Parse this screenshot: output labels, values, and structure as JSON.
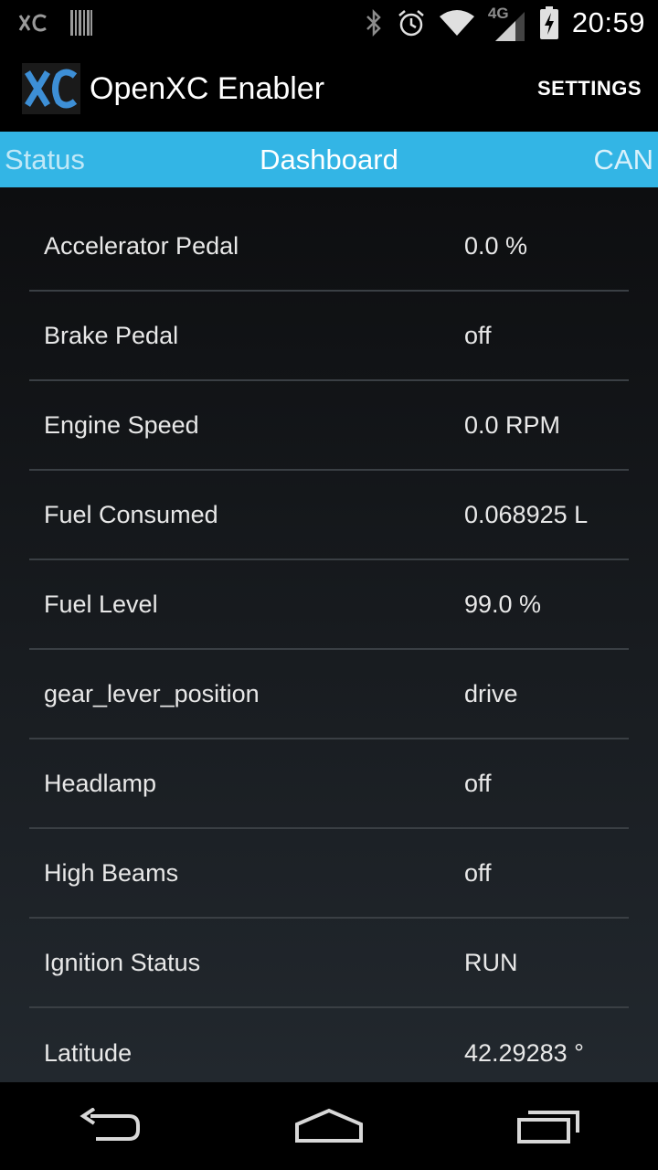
{
  "status_bar": {
    "time": "20:59",
    "network_label": "4G",
    "icons": [
      "xc-notification-icon",
      "barcode-icon",
      "bluetooth-icon",
      "alarm-icon",
      "wifi-icon",
      "signal-icon",
      "battery-charging-icon"
    ]
  },
  "action_bar": {
    "title": "OpenXC Enabler",
    "settings_label": "SETTINGS",
    "logo_icon": "openxc-logo-icon"
  },
  "tabs": {
    "left": "Status",
    "center": "Dashboard",
    "right": "CAN",
    "accent_color": "#33b5e5"
  },
  "measurements": [
    {
      "label": "Accelerator Pedal",
      "value": "0.0 %"
    },
    {
      "label": "Brake Pedal",
      "value": "off"
    },
    {
      "label": "Engine Speed",
      "value": "0.0 RPM"
    },
    {
      "label": "Fuel Consumed",
      "value": "0.068925 L"
    },
    {
      "label": "Fuel Level",
      "value": "99.0 %"
    },
    {
      "label": "gear_lever_position",
      "value": "drive"
    },
    {
      "label": "Headlamp",
      "value": "off"
    },
    {
      "label": "High Beams",
      "value": "off"
    },
    {
      "label": "Ignition Status",
      "value": "RUN"
    },
    {
      "label": "Latitude",
      "value": "42.29283 °"
    }
  ],
  "nav_bar": {
    "icons": [
      "back-icon",
      "home-icon",
      "recent-apps-icon"
    ]
  }
}
